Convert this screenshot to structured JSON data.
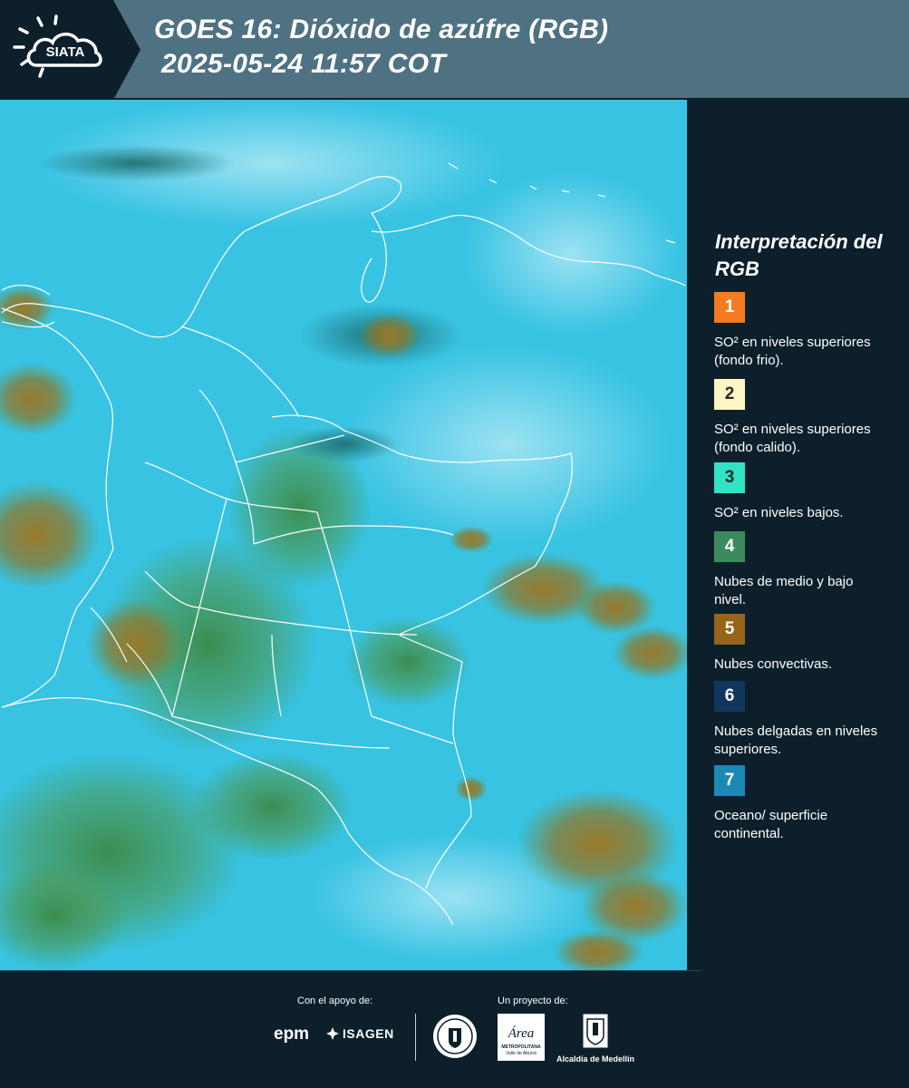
{
  "header": {
    "logo_text": "SIATA",
    "title_line1": "GOES 16: Dióxido de azúfre (RGB)",
    "title_line2": "2025-05-24 11:57 COT"
  },
  "legend": {
    "title": "Interpretación del RGB",
    "items": [
      {
        "number": "1",
        "label": "SO² en niveles superiores (fondo frio).",
        "color": "#f47c20",
        "text_color": "#ffffff"
      },
      {
        "number": "2",
        "label": "SO² en niveles superiores (fondo calido).",
        "color": "#fdf6c3",
        "text_color": "#2a2a2a"
      },
      {
        "number": "3",
        "label": "SO² en niveles bajos.",
        "color": "#2fe3c4",
        "text_color": "#2a2a2a"
      },
      {
        "number": "4",
        "label": "Nubes de medio y bajo nivel.",
        "color": "#3b8a5d",
        "text_color": "#ffffff"
      },
      {
        "number": "5",
        "label": "Nubes convectivas.",
        "color": "#97641a",
        "text_color": "#ffffff"
      },
      {
        "number": "6",
        "label": "Nubes delgadas en niveles superiores.",
        "color": "#11375f",
        "text_color": "#ffffff"
      },
      {
        "number": "7",
        "label": "Oceano/ superficie continental.",
        "color": "#1b88b5",
        "text_color": "#ffffff"
      }
    ]
  },
  "footer": {
    "support_label": "Con el apoyo de:",
    "project_label": "Un proyecto de:",
    "sponsors": [
      "epm",
      "ISAGEN"
    ],
    "partners": [
      "Área Metropolitana Valle de Aburrá",
      "Alcaldía de Medellín"
    ],
    "area_logo_text": "Área",
    "area_logo_sub": "METROPOLITANA",
    "area_logo_sub2": "Valle de Aburrá",
    "alcaldia_name": "Alcaldía de Medellín"
  },
  "colors": {
    "header_band": "#4f7282",
    "background": "#0c1f2b",
    "map_base": "#37c2e2",
    "border_lines": "#ffffff"
  }
}
